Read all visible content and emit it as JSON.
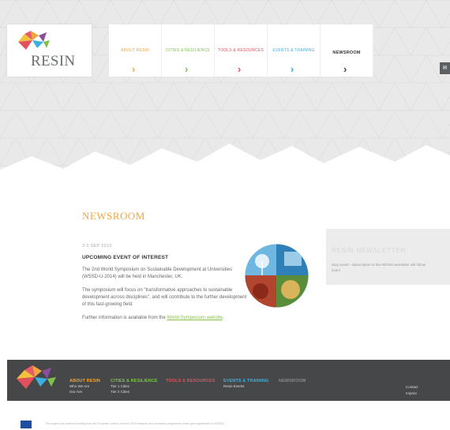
{
  "logo": {
    "text": "RESIN"
  },
  "nav": {
    "items": [
      {
        "label": "ABOUT RESIN",
        "color": "#f2a53c"
      },
      {
        "label": "CITIES & RESILIENCE",
        "color": "#7ec24a"
      },
      {
        "label": "TOOLS & RESOURCES",
        "color": "#e2505c"
      },
      {
        "label": "EVENTS & TRAINING",
        "color": "#3ab1e0"
      },
      {
        "label": "NEWSROOM",
        "color": "#444444"
      }
    ],
    "chevron": "›"
  },
  "page": {
    "title": "NEWSROOM"
  },
  "article": {
    "date": "3-5 SEP 2015",
    "headline": "UPCOMING EVENT OF INTEREST",
    "p1": "The 2nd World Symposium on Sustainable Development at Universities (WSSD-U-2014) will be held in Manchester, UK.",
    "p2": "The symposium will focus on \"transformative approaches to sustainable development across disciplines\", and will contribute to the further development of this fast-growing field.",
    "p3_prefix": "Further information is available from the ",
    "p3_link": "World Symposium website",
    "p3_suffix": "."
  },
  "newsletter": {
    "title": "RESIN NEWSLETTER",
    "text": "Stay tuned - subscription to the RESIN newsletter will follow soon!"
  },
  "footer": {
    "columns": [
      {
        "heading": "ABOUT RESIN",
        "color": "#f2a53c",
        "links": [
          "Who We Are",
          "Our Aim"
        ]
      },
      {
        "heading": "CITIES & RESILIENCE",
        "color": "#7ec24a",
        "links": [
          "Tier 1 Cities",
          "Tier 2 Cities"
        ]
      },
      {
        "heading": "TOOLS & RESOURCES",
        "color": "#e2505c",
        "links": []
      },
      {
        "heading": "EVENTS & TRAINING",
        "color": "#3ab1e0",
        "links": [
          "Resin Events"
        ]
      },
      {
        "heading": "NEWSROOM",
        "color": "#8a8b8d",
        "links": []
      }
    ],
    "right_links": [
      "Contact",
      "Imprint"
    ]
  },
  "eu": {
    "text": "This project has received funding from the European Union's Horizon 2020 research and innovation programme under grant agreement no 653522"
  },
  "icons": {
    "side_tab": "share-icon"
  }
}
